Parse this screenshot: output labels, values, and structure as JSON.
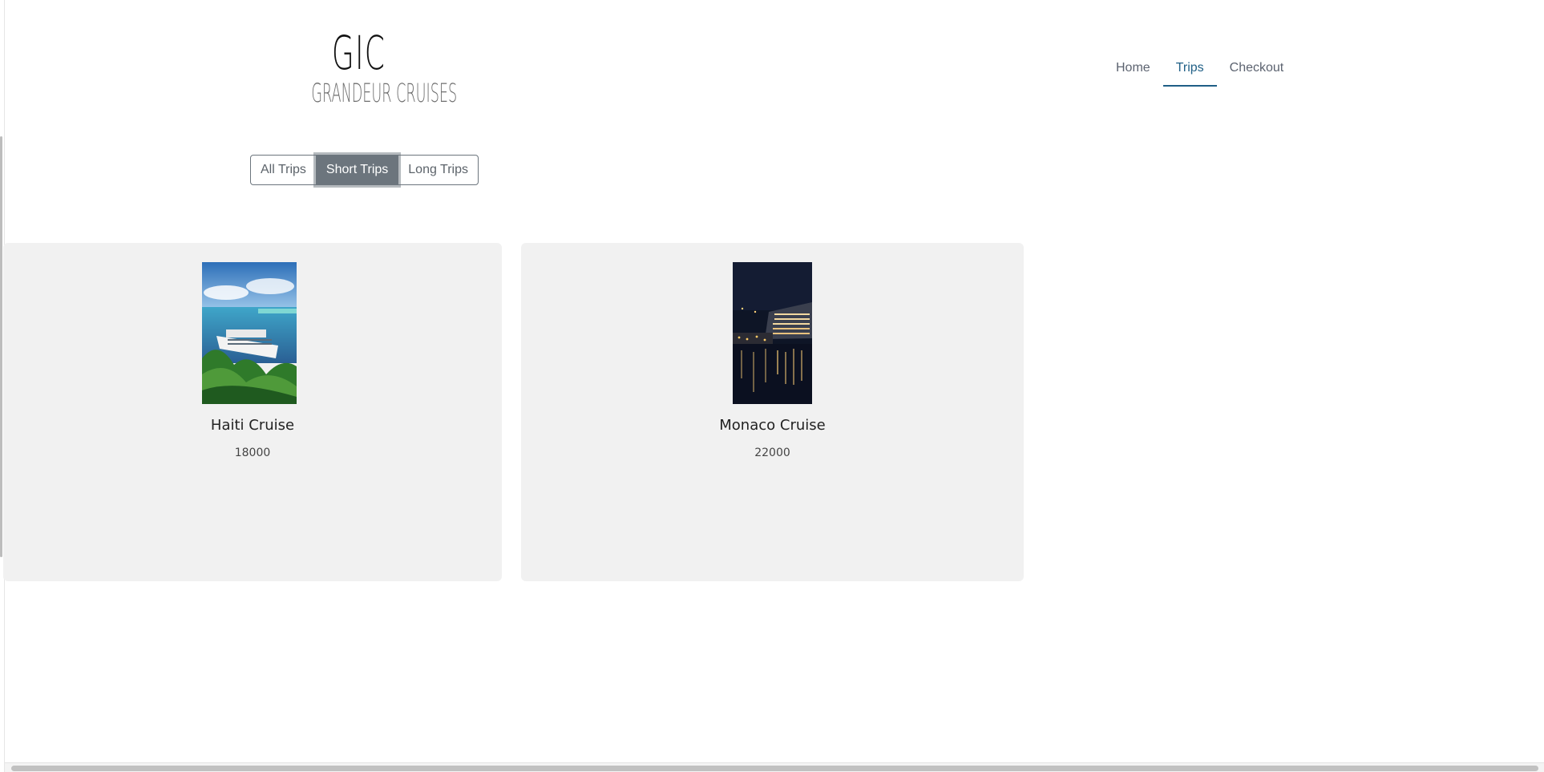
{
  "logo": {
    "mark": "GIC",
    "name": "GRANDEUR CRUISES"
  },
  "nav": {
    "items": [
      {
        "label": "Home"
      },
      {
        "label": "Trips"
      },
      {
        "label": "Checkout"
      }
    ],
    "active": "Trips"
  },
  "filters": {
    "items": [
      {
        "label": "All Trips"
      },
      {
        "label": "Short Trips"
      },
      {
        "label": "Long Trips"
      }
    ],
    "active": "Short Trips"
  },
  "trips": [
    {
      "title": "Haiti Cruise",
      "price": "18000"
    },
    {
      "title": "Monaco Cruise",
      "price": "22000"
    }
  ],
  "colors": {
    "accent": "#1f5f86",
    "button_active": "#6c757d",
    "card_bg": "#f1f1f1"
  }
}
